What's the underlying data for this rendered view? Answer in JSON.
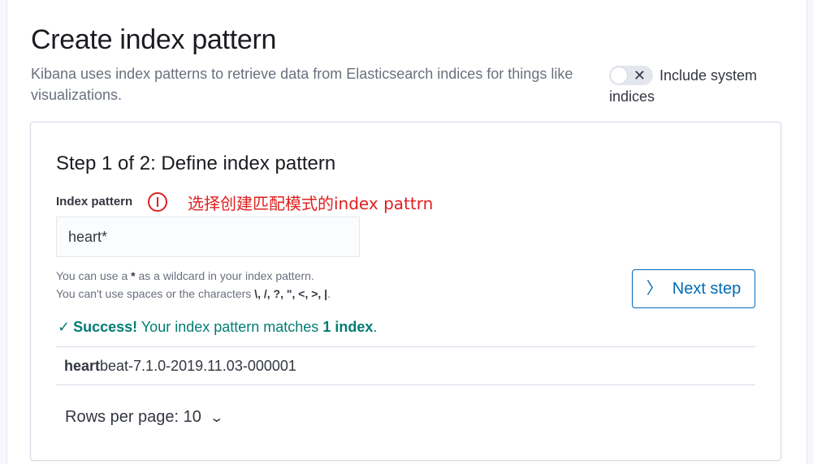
{
  "header": {
    "title": "Create index pattern",
    "description": "Kibana uses index patterns to retrieve data from Elasticsearch indices for things like visualizations.",
    "include_system_indices_label_line1": "Include system",
    "include_system_indices_label_line2": "indices",
    "toggle_state": "off",
    "toggle_icon": "close-icon"
  },
  "step": {
    "title": "Step 1 of 2: Define index pattern",
    "field_label": "Index pattern",
    "annotation_text": "选择创建匹配模式的index pattrn",
    "input_value": "heart*",
    "help_line1_prefix": "You can use a ",
    "help_line1_star": "*",
    "help_line1_suffix": " as a wildcard in your index pattern.",
    "help_line2_prefix": "You can't use spaces or the characters ",
    "help_line2_chars": "\\, /, ?, \", <, >, |",
    "help_line2_suffix": ".",
    "next_button_label": "Next step",
    "success_bold": "Success!",
    "success_text": " Your index pattern matches ",
    "success_count": "1 index",
    "success_end": ".",
    "matched_indices": [
      {
        "match": "heart",
        "rest": "beat-7.1.0-2019.11.03-000001"
      }
    ],
    "rows_per_page_label": "Rows per page: 10"
  },
  "colors": {
    "accent": "#006bb4",
    "success": "#017d73",
    "annotation": "#e02020"
  }
}
